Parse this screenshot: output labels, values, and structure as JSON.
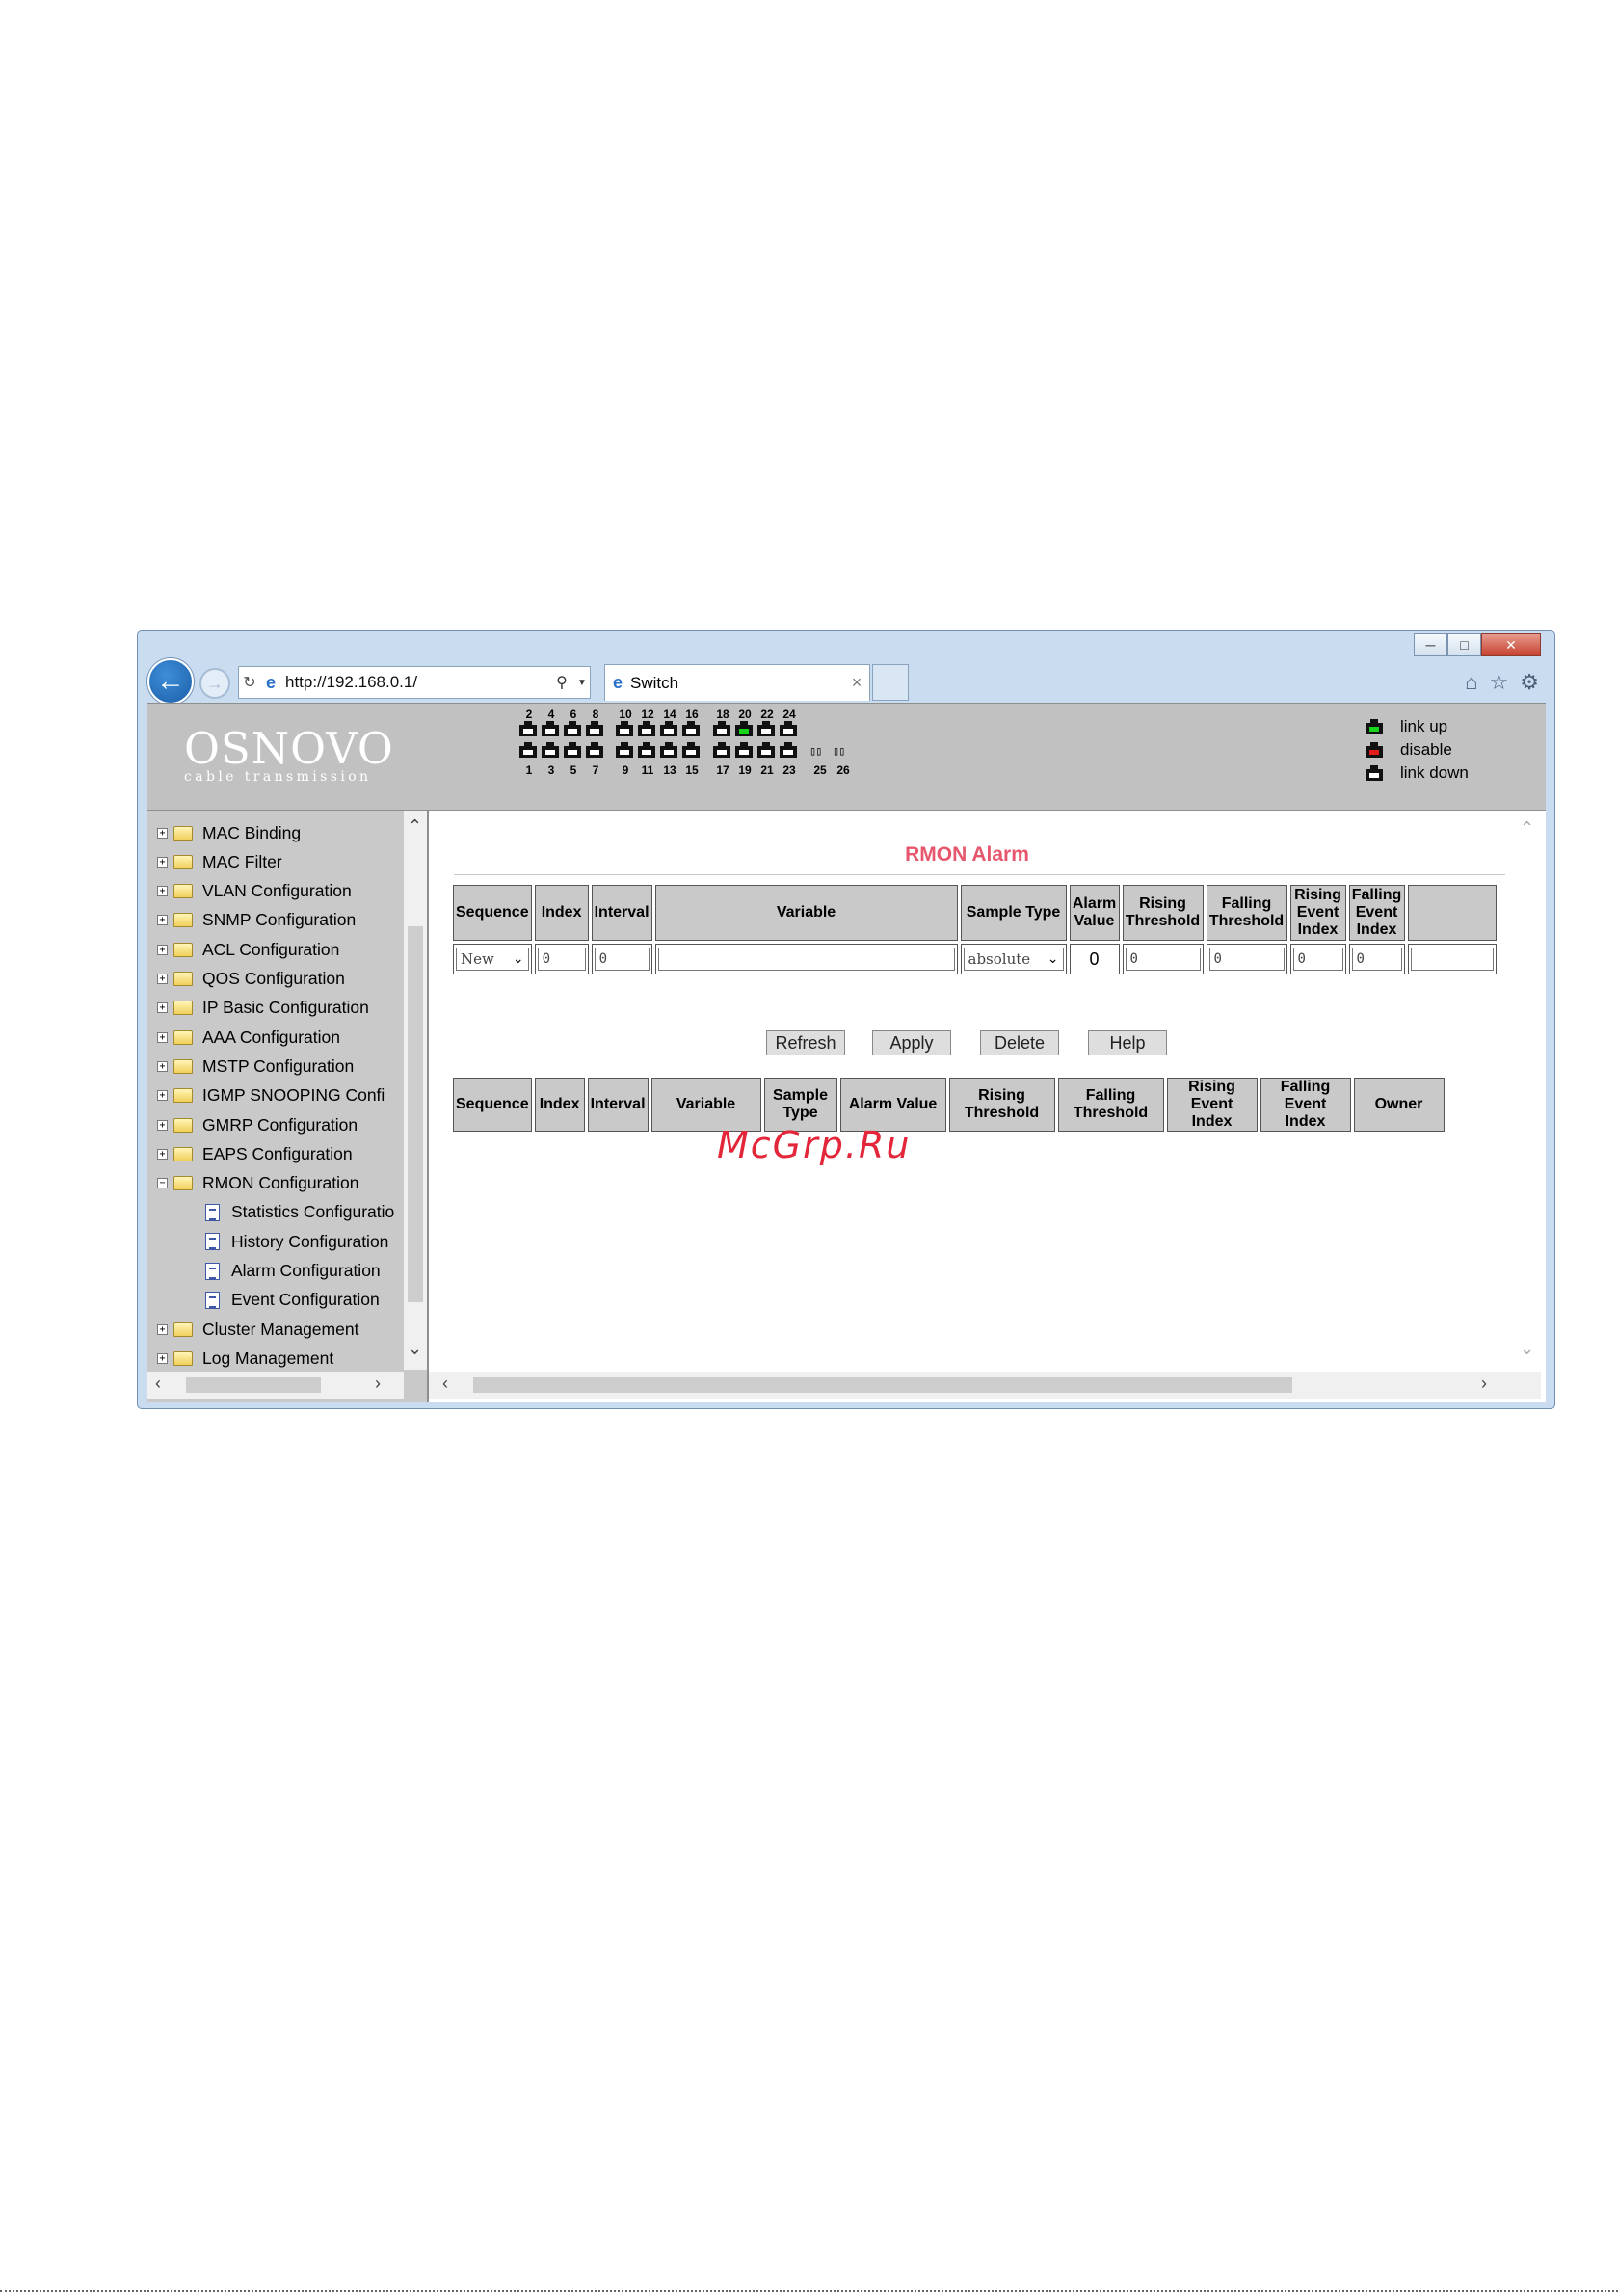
{
  "browser": {
    "url": "http://192.168.0.1/",
    "tab_title": "Switch",
    "window_controls": [
      "minimize-icon",
      "restore-icon",
      "close-icon"
    ],
    "toolbar_icons": [
      "home-icon",
      "star-icon",
      "gear-icon"
    ]
  },
  "header": {
    "logo_main": "OSNOVO",
    "logo_sub": "cable transmission",
    "ports_top": [
      "2",
      "4",
      "6",
      "8",
      "10",
      "12",
      "14",
      "16",
      "18",
      "20",
      "22",
      "24"
    ],
    "ports_bottom": [
      "1",
      "3",
      "5",
      "7",
      "9",
      "11",
      "13",
      "15",
      "17",
      "19",
      "21",
      "23"
    ],
    "sfp_ports": [
      "25",
      "26"
    ],
    "link_up_ports": [
      "20"
    ],
    "legend": [
      {
        "label": "link up",
        "color": "#17d51a"
      },
      {
        "label": "disable",
        "color": "#e31b1b"
      },
      {
        "label": "link down",
        "color": "#ffffff"
      }
    ]
  },
  "sidebar": {
    "items": [
      {
        "label": "MAC Binding",
        "type": "folder",
        "expanded": false
      },
      {
        "label": "MAC Filter",
        "type": "folder",
        "expanded": false
      },
      {
        "label": "VLAN Configuration",
        "type": "folder",
        "expanded": false
      },
      {
        "label": "SNMP Configuration",
        "type": "folder",
        "expanded": false
      },
      {
        "label": "ACL Configuration",
        "type": "folder",
        "expanded": false
      },
      {
        "label": "QOS Configuration",
        "type": "folder",
        "expanded": false
      },
      {
        "label": "IP Basic Configuration",
        "type": "folder",
        "expanded": false
      },
      {
        "label": "AAA Configuration",
        "type": "folder",
        "expanded": false
      },
      {
        "label": "MSTP Configuration",
        "type": "folder",
        "expanded": false
      },
      {
        "label": "IGMP SNOOPING Confi",
        "type": "folder",
        "expanded": false
      },
      {
        "label": "GMRP Configuration",
        "type": "folder",
        "expanded": false
      },
      {
        "label": "EAPS Configuration",
        "type": "folder",
        "expanded": false
      },
      {
        "label": "RMON Configuration",
        "type": "folder",
        "expanded": true
      },
      {
        "label": "Statistics Configuratio",
        "type": "page"
      },
      {
        "label": "History Configuration",
        "type": "page"
      },
      {
        "label": "Alarm Configuration",
        "type": "page"
      },
      {
        "label": "Event Configuration",
        "type": "page"
      },
      {
        "label": "Cluster Management",
        "type": "folder",
        "expanded": false
      },
      {
        "label": "Log Management",
        "type": "folder",
        "expanded": false
      }
    ]
  },
  "main": {
    "title": "RMON Alarm",
    "edit_table": {
      "headers": [
        "Sequence",
        "Index",
        "Interval",
        "Variable",
        "Sample Type",
        "Alarm Value",
        "Rising Threshold",
        "Falling Threshold",
        "Rising Event Index",
        "Falling Event Index",
        ""
      ],
      "row": {
        "sequence": "New",
        "index": "0",
        "interval": "0",
        "variable": "",
        "sample_type": "absolute",
        "alarm_value": "0",
        "rising_threshold": "0",
        "falling_threshold": "0",
        "rising_event_index": "0",
        "falling_event_index": "0",
        "owner": ""
      }
    },
    "buttons": {
      "refresh": "Refresh",
      "apply": "Apply",
      "delete": "Delete",
      "help": "Help"
    },
    "list_table": {
      "headers": [
        "Sequence",
        "Index",
        "Interval",
        "Variable",
        "Sample Type",
        "Alarm Value",
        "Rising Threshold",
        "Falling Threshold",
        "Rising Event Index",
        "Falling Event Index",
        "Owner"
      ]
    }
  },
  "watermark": "McGrp.Ru"
}
